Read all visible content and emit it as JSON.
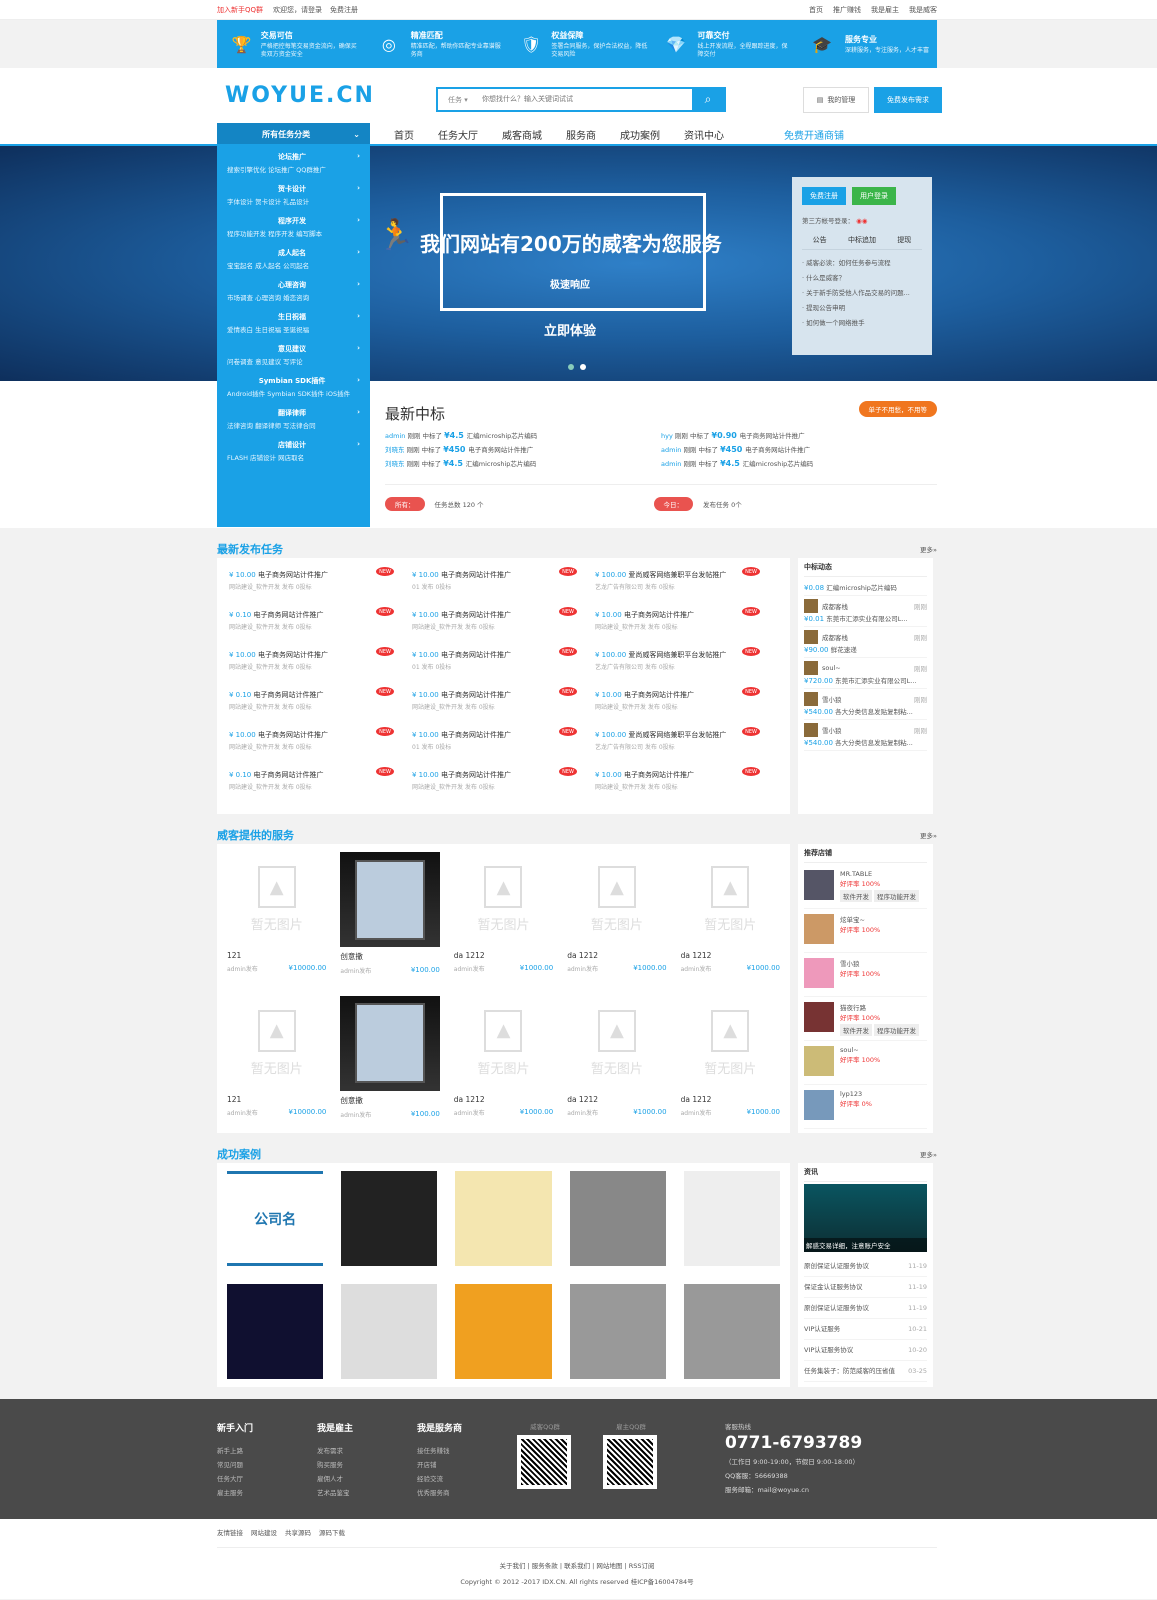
{
  "topbar": {
    "join": "加入新手QQ群",
    "hello": "欢迎您，",
    "login": "请登录",
    "register": "免费注册",
    "links": [
      "首页",
      "推广赚钱",
      "我是雇主",
      "我是威客"
    ]
  },
  "features": [
    {
      "icon": "trophy-icon",
      "title": "交易可信",
      "desc": "严格把控每笔交易资金流向，确保买卖双方资金安全"
    },
    {
      "icon": "target-icon",
      "title": "精准匹配",
      "desc": "精准匹配，帮助你匹配专业靠谱服务商"
    },
    {
      "icon": "shield-icon",
      "title": "权益保障",
      "desc": "签署合同服务，保护合法权益，降低交易风险"
    },
    {
      "icon": "diamond-icon",
      "title": "可靠交付",
      "desc": "线上开发流程，全程跟踪进度，保障交付"
    },
    {
      "icon": "graduate-icon",
      "title": "服务专业",
      "desc": "深耕服务，专注服务，人才丰富"
    }
  ],
  "header": {
    "logo": "WOYUE.CN",
    "search_type": "任务",
    "search_placeholder": "你想找什么？输入关键词试试",
    "manage": "我的管理",
    "publish": "免费发布需求"
  },
  "nav": {
    "category": "所有任务分类",
    "links": [
      "首页",
      "任务大厅",
      "威客商城",
      "服务商",
      "成功案例",
      "资讯中心"
    ],
    "free": "免费开通商铺"
  },
  "categories": [
    {
      "title": "论坛推广",
      "items": "搜索引擎优化 论坛推广 QQ群推广"
    },
    {
      "title": "贺卡设计",
      "items": "字体设计 贺卡设计 礼品设计"
    },
    {
      "title": "程序开发",
      "items": "程序功能开发 程序开发 编写脚本"
    },
    {
      "title": "成人起名",
      "items": "宝宝起名 成人起名 公司起名"
    },
    {
      "title": "心理咨询",
      "items": "市场调查 心理咨询 婚恋咨询"
    },
    {
      "title": "生日祝福",
      "items": "爱情表白 生日祝福 圣诞祝福"
    },
    {
      "title": "意见建议",
      "items": "问卷调查 意见建议 写评论"
    },
    {
      "title": "Symbian SDK插件",
      "items": "Android插件 Symbian SDK插件 iOS插件"
    },
    {
      "title": "翻译律师",
      "items": "法律咨询 翻译律师 写法律合同"
    },
    {
      "title": "店铺设计",
      "items": "FLASH 店铺设计 网店取名"
    }
  ],
  "banner": {
    "title": "我们网站有200万的威客为您服务",
    "sub": "极速响应",
    "cta": "立即体验"
  },
  "login_box": {
    "reg": "免费注册",
    "login": "用户登录",
    "third": "第三方帐号登录：",
    "tabs": [
      "公告",
      "中标追加",
      "提现"
    ],
    "notices": [
      "· 威客必读：如何任务参与流程",
      "· 什么是威客？",
      "· 关于新手防受他人作品交易的问题...",
      "· 提现公告申明",
      "· 如何做一个网络推手"
    ]
  },
  "latest": {
    "title": "最新中标",
    "badge": "单子不用愁，不用等",
    "bids": [
      {
        "user": "admin",
        "action": "刚刚 中标了",
        "money": "¥4.5",
        "task": "汇编microship芯片编码"
      },
      {
        "user": "hyy",
        "action": "刚刚 中标了",
        "money": "¥0.90",
        "task": "电子商务网站计件推广"
      },
      {
        "user": "刘晓东",
        "action": "刚刚 中标了",
        "money": "¥450",
        "task": "电子商务网站计件推广"
      },
      {
        "user": "admin",
        "action": "刚刚 中标了",
        "money": "¥450",
        "task": "电子商务网站计件推广"
      },
      {
        "user": "刘晓东",
        "action": "刚刚 中标了",
        "money": "¥4.5",
        "task": "汇编microship芯片编码"
      },
      {
        "user": "admin",
        "action": "刚刚 中标了",
        "money": "¥4.5",
        "task": "汇编microship芯片编码"
      }
    ],
    "all": "所有：",
    "total": "任务总数 120 个",
    "today": "今日：",
    "today_count": "发布任务 0个"
  },
  "tasks_section": {
    "title": "最新发布任务",
    "more": "更多»"
  },
  "tasks": [
    {
      "price": "¥ 10.00",
      "name": "电子商务网站计件推广",
      "meta": "网站建设_软件开发 发布 0投标"
    },
    {
      "price": "¥ 10.00",
      "name": "电子商务网站计件推广",
      "meta": "01 发布 0投标"
    },
    {
      "price": "¥ 100.00",
      "name": "爱尚威客网络兼职平台发帖推广",
      "meta": "艺龙广告有限公司 发布 0投标"
    },
    {
      "price": "¥ 0.10",
      "name": "电子商务网站计件推广",
      "meta": "网站建设_软件开发 发布 0投标"
    },
    {
      "price": "¥ 10.00",
      "name": "电子商务网站计件推广",
      "meta": "网站建设_软件开发 发布 0投标"
    },
    {
      "price": "¥ 10.00",
      "name": "电子商务网站计件推广",
      "meta": "网站建设_软件开发 发布 0投标"
    },
    {
      "price": "¥ 10.00",
      "name": "电子商务网站计件推广",
      "meta": "网站建设_软件开发 发布 0投标"
    },
    {
      "price": "¥ 10.00",
      "name": "电子商务网站计件推广",
      "meta": "01 发布 0投标"
    },
    {
      "price": "¥ 100.00",
      "name": "爱尚威客网络兼职平台发帖推广",
      "meta": "艺龙广告有限公司 发布 0投标"
    },
    {
      "price": "¥ 0.10",
      "name": "电子商务网站计件推广",
      "meta": "网站建设_软件开发 发布 0投标"
    },
    {
      "price": "¥ 10.00",
      "name": "电子商务网站计件推广",
      "meta": "网站建设_软件开发 发布 0投标"
    },
    {
      "price": "¥ 10.00",
      "name": "电子商务网站计件推广",
      "meta": "网站建设_软件开发 发布 0投标"
    },
    {
      "price": "¥ 10.00",
      "name": "电子商务网站计件推广",
      "meta": "网站建设_软件开发 发布 0投标"
    },
    {
      "price": "¥ 10.00",
      "name": "电子商务网站计件推广",
      "meta": "01 发布 0投标"
    },
    {
      "price": "¥ 100.00",
      "name": "爱尚威客网络兼职平台发帖推广",
      "meta": "艺龙广告有限公司 发布 0投标"
    },
    {
      "price": "¥ 0.10",
      "name": "电子商务网站计件推广",
      "meta": "网站建设_软件开发 发布 0投标"
    },
    {
      "price": "¥ 10.00",
      "name": "电子商务网站计件推广",
      "meta": "网站建设_软件开发 发布 0投标"
    },
    {
      "price": "¥ 10.00",
      "name": "电子商务网站计件推广",
      "meta": "网站建设_软件开发 发布 0投标"
    }
  ],
  "dynamics": {
    "title": "中标动态",
    "items": [
      {
        "user": "",
        "time": "",
        "money": "¥0.08",
        "task": "汇编microship芯片编码"
      },
      {
        "user": "成都客栈",
        "time": "刚刚",
        "money": "¥0.01",
        "task": "东莞市汇添实业有限公司L..."
      },
      {
        "user": "成都客栈",
        "time": "刚刚",
        "money": "¥90.00",
        "task": "鲜花速递"
      },
      {
        "user": "soul~",
        "time": "刚刚",
        "money": "¥720.00",
        "task": "东莞市汇添实业有限公司L..."
      },
      {
        "user": "雪小狼",
        "time": "刚刚",
        "money": "¥540.00",
        "task": "各大分类信息发贴复制粘..."
      },
      {
        "user": "雪小狼",
        "time": "刚刚",
        "money": "¥540.00",
        "task": "各大分类信息发贴复制粘..."
      }
    ]
  },
  "services_section": {
    "title": "威客提供的服务",
    "more": "更多»",
    "noimg": "暂无图片"
  },
  "services": [
    {
      "name": "121",
      "by": "admin发布",
      "price": "¥10000.00",
      "dark": false
    },
    {
      "name": "创意撒",
      "by": "admin发布",
      "price": "¥100.00",
      "dark": true
    },
    {
      "name": "da 1212",
      "by": "admin发布",
      "price": "¥1000.00",
      "dark": false
    },
    {
      "name": "da 1212",
      "by": "admin发布",
      "price": "¥1000.00",
      "dark": false
    },
    {
      "name": "da 1212",
      "by": "admin发布",
      "price": "¥1000.00",
      "dark": false
    },
    {
      "name": "121",
      "by": "admin发布",
      "price": "¥10000.00",
      "dark": false
    },
    {
      "name": "创意撒",
      "by": "admin发布",
      "price": "¥100.00",
      "dark": true
    },
    {
      "name": "da 1212",
      "by": "admin发布",
      "price": "¥1000.00",
      "dark": false
    },
    {
      "name": "da 1212",
      "by": "admin发布",
      "price": "¥1000.00",
      "dark": false
    },
    {
      "name": "da 1212",
      "by": "admin发布",
      "price": "¥1000.00",
      "dark": false
    }
  ],
  "shops": {
    "title": "推荐店铺",
    "items": [
      {
        "name": "MR.TABLE",
        "rate": "好评率 100%",
        "tags": [
          "软件开发",
          "程序功能开发"
        ],
        "color": "#556"
      },
      {
        "name": "炫单宝~",
        "rate": "好评率 100%",
        "tags": [],
        "color": "#c96"
      },
      {
        "name": "雪小狼",
        "rate": "好评率 100%",
        "tags": [],
        "color": "#e9b"
      },
      {
        "name": "猫夜行路",
        "rate": "好评率 100%",
        "tags": [
          "软件开发",
          "程序功能开发"
        ],
        "color": "#733"
      },
      {
        "name": "soul~",
        "rate": "好评率 100%",
        "tags": [],
        "color": "#cb7"
      },
      {
        "name": "lyp123",
        "rate": "好评率 0%",
        "tags": [],
        "color": "#79b"
      }
    ]
  },
  "cases_section": {
    "title": "成功案例",
    "more": "更多»",
    "first_label": "公司名"
  },
  "cases": [
    "#fff",
    "#222",
    "#f4e6b0",
    "#888",
    "#eee",
    "#101030",
    "#ddd",
    "#f0a020",
    "#999",
    "#999"
  ],
  "news": {
    "title": "资讯",
    "img_caption": "解惑交易详细，注意账户安全",
    "items": [
      {
        "t": "原创保证认证服务协议",
        "d": "11-19"
      },
      {
        "t": "保证金认证服务协议",
        "d": "11-19"
      },
      {
        "t": "原创保证认证服务协议",
        "d": "11-19"
      },
      {
        "t": "VIP认证服务",
        "d": "10-21"
      },
      {
        "t": "VIP认证服务协议",
        "d": "10-20"
      },
      {
        "t": "任务集装子：防范威客的压省值",
        "d": "03-25"
      }
    ]
  },
  "footer": {
    "cols": [
      {
        "title": "新手入门",
        "items": [
          "新手上路",
          "常见问题",
          "任务大厅",
          "雇主服务"
        ]
      },
      {
        "title": "我是雇主",
        "items": [
          "发布需求",
          "购买服务",
          "雇佣人才",
          "艺术品鉴宝"
        ]
      },
      {
        "title": "我是服务商",
        "items": [
          "接任务赚钱",
          "开店铺",
          "经验交流",
          "优秀服务商"
        ]
      }
    ],
    "qr1": "威客QQ群",
    "qr2": "雇主QQ群",
    "hotline_label": "客服热线",
    "phone": "0771-6793789",
    "hours": "（工作日 9:00-19:00，节假日 9:00-18:00）",
    "qq": "QQ客服：56669388",
    "mail": "服务邮箱：mail@woyue.cn"
  },
  "bottom": {
    "friends": [
      "友情链接",
      "网站建设",
      "共享源码",
      "源码下载"
    ],
    "links": "关于我们 | 服务条款 | 联系我们 | 网站地图 | RSS订阅",
    "copyright": "Copyright © 2012 -2017 IDX.CN. All rights reserved 桂ICP备16004784号"
  }
}
